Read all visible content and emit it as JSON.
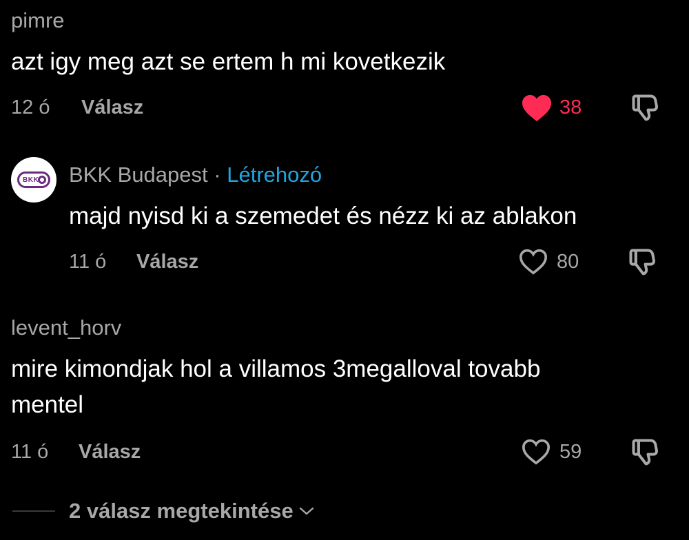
{
  "comments": [
    {
      "username": "pimre",
      "text": "azt igy meg azt se ertem h mi kovetkezik",
      "time": "12 ó",
      "reply_label": "Válasz",
      "likes": "38",
      "liked": true
    },
    {
      "username": "BKK Budapest",
      "separator": "·",
      "creator_label": "Létrehozó",
      "avatar_text": "BKK",
      "text": "majd nyisd ki a szemedet és nézz ki az ablakon",
      "time": "11 ó",
      "reply_label": "Válasz",
      "likes": "80",
      "liked": false
    },
    {
      "username": "levent_horv",
      "text_line1": "mire kimondjak hol a villamos 3megalloval tovabb",
      "text_line2": "mentel",
      "time": "11 ó",
      "reply_label": "Válasz",
      "likes": "59",
      "liked": false
    }
  ],
  "view_replies": "2 válasz megtekintése",
  "colors": {
    "background": "#000000",
    "liked_heart": "#fe2c55",
    "creator_badge": "#20a6e0",
    "secondary_text": "#a8a8a8"
  },
  "icons": [
    "heart-filled-icon",
    "heart-outline-icon",
    "dislike-icon",
    "chevron-down-icon",
    "bkk-logo-icon"
  ]
}
